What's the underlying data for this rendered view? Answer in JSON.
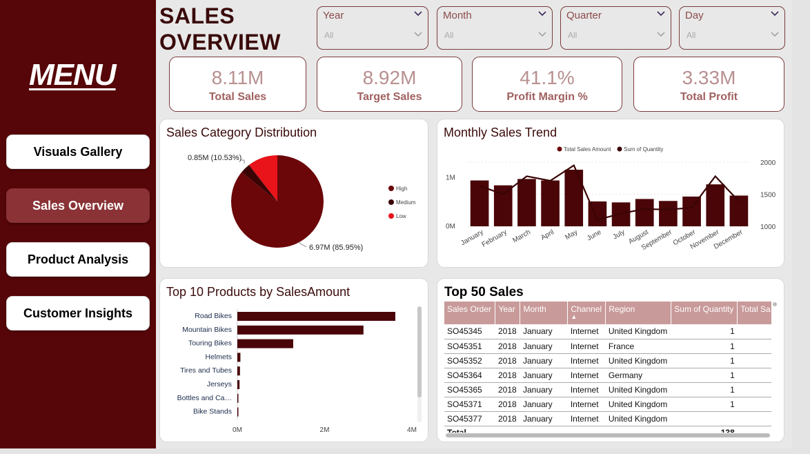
{
  "sidebar": {
    "menu_title": "MENU",
    "buttons": [
      {
        "label": "Visuals Gallery",
        "active": false
      },
      {
        "label": "Sales Overview",
        "active": true
      },
      {
        "label": "Product Analysis",
        "active": false
      },
      {
        "label": "Customer Insights",
        "active": false
      }
    ]
  },
  "header": {
    "title_line1": "SALES",
    "title_line2": "OVERVIEW"
  },
  "slicers": [
    {
      "label": "Year",
      "value": "All"
    },
    {
      "label": "Month",
      "value": "All"
    },
    {
      "label": "Quarter",
      "value": "All"
    },
    {
      "label": "Day",
      "value": "All"
    }
  ],
  "kpis": [
    {
      "value": "8.11M",
      "label": "Total Sales"
    },
    {
      "value": "8.92M",
      "label": "Target Sales"
    },
    {
      "value": "41.1%",
      "label": "Profit Margin %"
    },
    {
      "value": "3.33M",
      "label": "Total Profit"
    }
  ],
  "colors": {
    "sidebar": "#560608",
    "high": "#6b0609",
    "medium": "#3a0405",
    "low": "#e8141a",
    "bar": "#4a0508"
  },
  "pie": {
    "title": "Sales Category Distribution",
    "label_small": "0.85M (10.53%)",
    "label_large": "6.97M (85.95%)"
  },
  "trend": {
    "title": "Monthly Sales Trend"
  },
  "products": {
    "title": "Top 10 Products by SalesAmount"
  },
  "table": {
    "title": "Top 50 Sales",
    "columns": [
      "Sales Order",
      "Year",
      "Month",
      "Channel",
      "Region",
      "Sum of Quantity",
      "Total Sa"
    ],
    "rows": [
      [
        "SO45345",
        "2018",
        "January",
        "Internet",
        "United Kingdom",
        "1",
        ""
      ],
      [
        "SO45351",
        "2018",
        "January",
        "Internet",
        "France",
        "1",
        ""
      ],
      [
        "SO45352",
        "2018",
        "January",
        "Internet",
        "United Kingdom",
        "1",
        ""
      ],
      [
        "SO45364",
        "2018",
        "January",
        "Internet",
        "Germany",
        "1",
        ""
      ],
      [
        "SO45365",
        "2018",
        "January",
        "Internet",
        "United Kingdom",
        "1",
        ""
      ],
      [
        "SO45371",
        "2018",
        "January",
        "Internet",
        "United Kingdom",
        "1",
        ""
      ],
      [
        "SO45377",
        "2018",
        "January",
        "Internet",
        "United Kingdom",
        "",
        ""
      ]
    ],
    "total_label": "Total",
    "total_quantity": "138"
  },
  "chart_data": [
    {
      "type": "pie",
      "title": "Sales Category Distribution",
      "slices": [
        {
          "name": "High",
          "value": 6.97,
          "percent": 85.95
        },
        {
          "name": "Medium",
          "value": 0.29,
          "percent": 3.52
        },
        {
          "name": "Low",
          "value": 0.85,
          "percent": 10.53
        }
      ],
      "legend": [
        "High",
        "Medium",
        "Low"
      ],
      "legend_position": "right"
    },
    {
      "type": "bar",
      "title": "Monthly Sales Trend",
      "categories": [
        "January",
        "February",
        "March",
        "April",
        "May",
        "June",
        "July",
        "August",
        "September",
        "October",
        "November",
        "December"
      ],
      "series": [
        {
          "name": "Total Sales Amount",
          "type": "bar",
          "axis": "left",
          "values": [
            0.94,
            0.84,
            0.97,
            0.94,
            1.16,
            0.51,
            0.49,
            0.56,
            0.52,
            0.61,
            0.86,
            0.63
          ]
        },
        {
          "name": "Sum of Quantity",
          "type": "line",
          "axis": "right",
          "values": [
            1630,
            1500,
            1780,
            1710,
            1950,
            1100,
            1200,
            1270,
            1260,
            1290,
            1780,
            1390
          ]
        }
      ],
      "left_axis": {
        "ticks": [
          "0M",
          "1M"
        ],
        "range": [
          0,
          1.4
        ]
      },
      "right_axis": {
        "ticks": [
          "1000",
          "1500",
          "2000"
        ],
        "range": [
          1000,
          2000
        ]
      },
      "legend_position": "top"
    },
    {
      "type": "bar",
      "orientation": "horizontal",
      "title": "Top 10 Products by SalesAmount",
      "categories": [
        "Road Bikes",
        "Mountain Bikes",
        "Touring Bikes",
        "Helmets",
        "Tires and Tubes",
        "Jerseys",
        "Bottles and Ca…",
        "Bike Stands"
      ],
      "values": [
        3.62,
        2.89,
        1.28,
        0.07,
        0.06,
        0.05,
        0.02,
        0.02
      ],
      "x_ticks": [
        "0M",
        "2M",
        "4M"
      ],
      "xlim": [
        0,
        4.0
      ]
    }
  ]
}
